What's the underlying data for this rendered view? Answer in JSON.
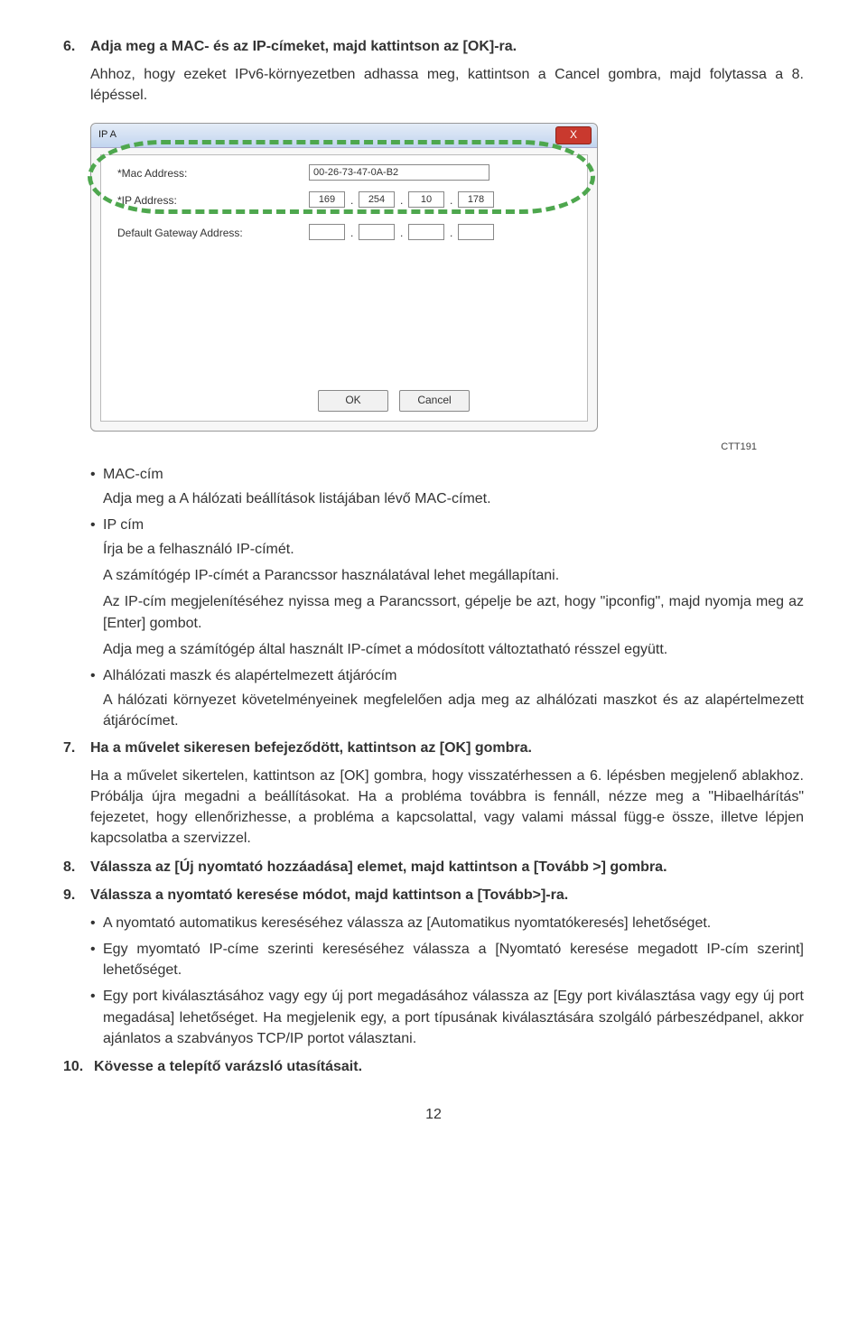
{
  "step6": {
    "num": "6.",
    "title": "Adja meg a MAC- és az IP-címeket, majd kattintson az [OK]-ra.",
    "line1": "Ahhoz, hogy ezeket IPv6-környezetben adhassa meg, kattintson a Cancel gombra, majd folytassa a 8. lépéssel."
  },
  "dialog": {
    "title_partial": "IP A",
    "close_x": "X",
    "mac_label": "*Mac Address:",
    "mac_value": "00-26-73-47-0A-B2",
    "ip_label": "*IP Address:",
    "ip_a": "169",
    "ip_b": "254",
    "ip_c": "10",
    "ip_d": "178",
    "gateway_label": "Default Gateway Address:",
    "ok": "OK",
    "cancel": "Cancel"
  },
  "img_code": "CTT191",
  "after6": {
    "mac_head": "MAC-cím",
    "mac_body": "Adja meg a A hálózati beállítások listájában lévő MAC-címet.",
    "ip_head": "IP cím",
    "ip_l1": "Írja be a felhasználó IP-címét.",
    "ip_l2": "A számítógép IP-címét a Parancssor használatával lehet megállapítani.",
    "ip_l3": "Az IP-cím megjelenítéséhez nyissa meg a Parancssort, gépelje be azt, hogy \"ipconfig\", majd nyomja meg az [Enter] gombot.",
    "ip_l4": "Adja meg a számítógép által használt IP-címet a módosított változtatható résszel együtt.",
    "gw_head": "Alhálózati maszk és alapértelmezett átjárócím",
    "gw_body": "A hálózati környezet követelményeinek megfelelően adja meg az alhálózati maszkot és az alapértelmezett átjárócímet."
  },
  "step7": {
    "num": "7.",
    "title": "Ha a művelet sikeresen befejeződött, kattintson az [OK] gombra.",
    "body": "Ha a művelet sikertelen, kattintson az [OK] gombra, hogy visszatérhessen a 6. lépésben megjelenő ablakhoz. Próbálja újra megadni a beállításokat. Ha a probléma továbbra is fennáll, nézze meg a \"Hibaelhárítás\" fejezetet, hogy ellenőrizhesse, a probléma a kapcsolattal, vagy valami mással függ-e össze, illetve lépjen kapcsolatba a szervizzel."
  },
  "step8": {
    "num": "8.",
    "title": "Válassza az [Új nyomtató hozzáadása] elemet, majd kattintson a [Tovább >] gombra."
  },
  "step9": {
    "num": "9.",
    "title": "Válassza a nyomtató keresése módot, majd kattintson a [Tovább>]-ra.",
    "b1": "A nyomtató automatikus kereséséhez válassza az [Automatikus nyomtatókeresés] lehetőséget.",
    "b2": "Egy myomtató IP-címe szerinti kereséséhez válassza a [Nyomtató keresése megadott IP-cím szerint] lehetőséget.",
    "b3": "Egy port kiválasztásához vagy egy új port megadásához válassza az [Egy port kiválasztása vagy egy új port megadása] lehetőséget. Ha megjelenik egy, a port típusának kiválasztására szolgáló párbeszédpanel, akkor ajánlatos a szabványos TCP/IP portot választani."
  },
  "step10": {
    "num": "10.",
    "title": "Kövesse a telepítő varázsló utasításait."
  },
  "page_number": "12"
}
